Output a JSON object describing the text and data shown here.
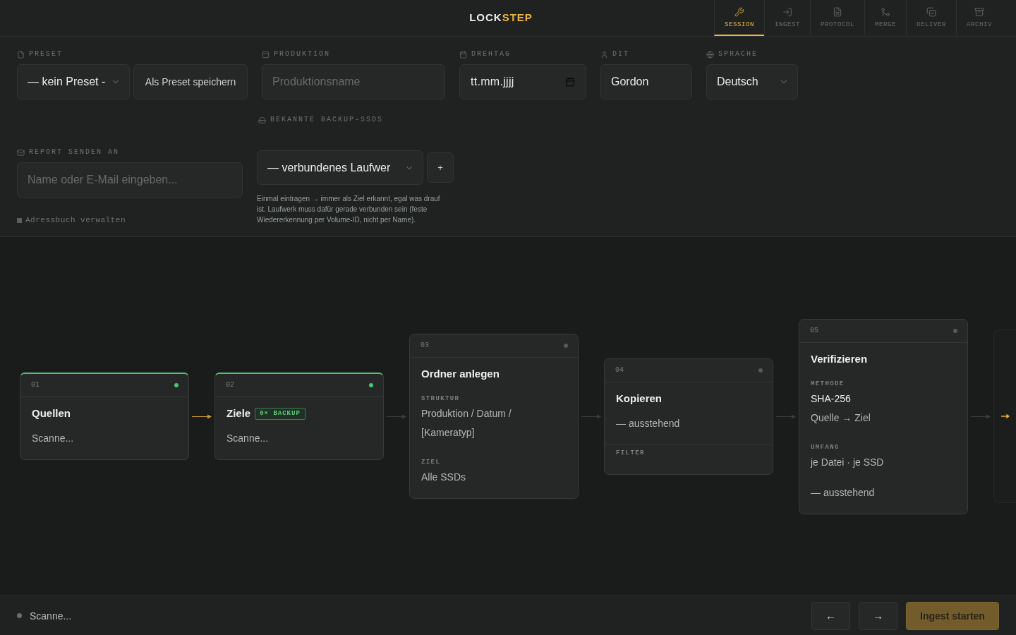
{
  "app": {
    "logo": [
      {
        "text": "LOCK",
        "accent": false
      },
      {
        "text": "STEP",
        "accent": true
      }
    ]
  },
  "tabs": [
    {
      "label": "SESSION",
      "selected": true
    },
    {
      "label": "INGEST",
      "selected": false
    },
    {
      "label": "PROTOCOL",
      "selected": false
    },
    {
      "label": "MERGE",
      "selected": false
    },
    {
      "label": "DELIVER",
      "selected": false
    },
    {
      "label": "ARCHIV",
      "selected": false
    }
  ],
  "session_form": {
    "preset": {
      "label": "PRESET",
      "select_value": "— kein Preset -",
      "save_button": "Als Preset speichern"
    },
    "production": {
      "label": "PRODUKTION",
      "placeholder": "Produktionsname"
    },
    "shoot_day": {
      "label": "DREHTAG",
      "placeholder": "tt.mm.jjjj"
    },
    "dit": {
      "label": "DIT",
      "value": "Gordon"
    },
    "language": {
      "label": "SPRACHE",
      "value": "Deutsch"
    },
    "backup_ssds": {
      "label": "BEKANNTE BACKUP-SSDS",
      "select_value": "— verbundenes Laufwer",
      "add_button": "+",
      "hint": "Einmal eintragen → immer als Ziel erkannt, egal was drauf ist. Laufwerk muss dafür gerade verbunden sein (feste Wiedererkennung per Volume-ID, nicht per Name)."
    },
    "report": {
      "label": "REPORT SENDEN AN",
      "placeholder": "Name oder E-Mail eingeben...",
      "address_book_link": "Adressbuch verwalten"
    }
  },
  "pipeline": {
    "nodes": [
      {
        "number": "01",
        "title": "Quellen",
        "ready": true,
        "blocks": [
          {
            "kind": "text",
            "text": "Scanne..."
          }
        ]
      },
      {
        "number": "02",
        "title": "Ziele",
        "badge": "0× BACKUP",
        "ready": true,
        "blocks": [
          {
            "kind": "text",
            "text": "Scanne..."
          }
        ]
      },
      {
        "number": "03",
        "title": "Ordner anlegen",
        "ready": false,
        "blocks": [
          {
            "kind": "section",
            "label": "STRUKTUR",
            "lines": [
              {
                "text": "Produktion / Datum / [Kameratyp]",
                "strong": false
              }
            ]
          },
          {
            "kind": "section",
            "label": "ZIEL",
            "lines": [
              {
                "text": "Alle SSDs",
                "strong": false
              }
            ]
          }
        ]
      },
      {
        "number": "04",
        "title": "Kopieren",
        "ready": false,
        "blocks": [
          {
            "kind": "text",
            "text": "— ausstehend"
          }
        ],
        "footer": {
          "label": "FILTER"
        }
      },
      {
        "number": "05",
        "title": "Verifizieren",
        "ready": false,
        "blocks": [
          {
            "kind": "section",
            "label": "METHODE",
            "lines": [
              {
                "text": "SHA-256",
                "strong": true
              },
              {
                "text": "Quelle → Ziel",
                "strong": false
              }
            ]
          },
          {
            "kind": "section",
            "label": "UMFANG",
            "lines": [
              {
                "text": "je Datei · je SSD",
                "strong": false
              }
            ]
          },
          {
            "kind": "text",
            "text": "— ausstehend"
          }
        ]
      }
    ],
    "connectors": [
      {
        "active": true
      },
      {
        "active": false
      },
      {
        "active": false
      },
      {
        "active": false
      },
      {
        "active": false
      }
    ]
  },
  "footer": {
    "status": "Scanne...",
    "back_button": "←",
    "next_button": "→",
    "start_button": {
      "label": "Ingest starten",
      "disabled": true
    }
  }
}
